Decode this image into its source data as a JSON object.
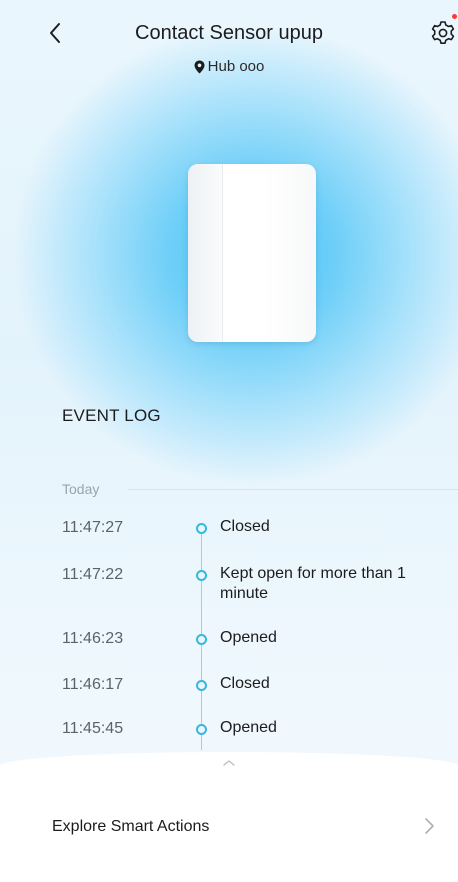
{
  "header": {
    "title": "Contact Sensor upup",
    "location": "Hub ooo"
  },
  "event_log": {
    "title": "EVENT LOG",
    "day_label": "Today",
    "events": [
      {
        "time": "11:47:27",
        "description": "Closed"
      },
      {
        "time": "11:47:22",
        "description": "Kept open for more than 1 minute"
      },
      {
        "time": "11:46:23",
        "description": "Opened"
      },
      {
        "time": "11:46:17",
        "description": "Closed"
      },
      {
        "time": "11:45:45",
        "description": "Opened"
      }
    ]
  },
  "bottom_sheet": {
    "explore_label": "Explore Smart Actions"
  },
  "icons": {
    "back": "chevron-left-icon",
    "settings": "gear-icon",
    "location": "location-pin-icon",
    "sheet_handle": "chevron-up-icon",
    "explore": "chevron-right-icon"
  },
  "colors": {
    "accent": "#34b8dc",
    "glow": "#41bff6",
    "notification": "#ff3b30"
  }
}
